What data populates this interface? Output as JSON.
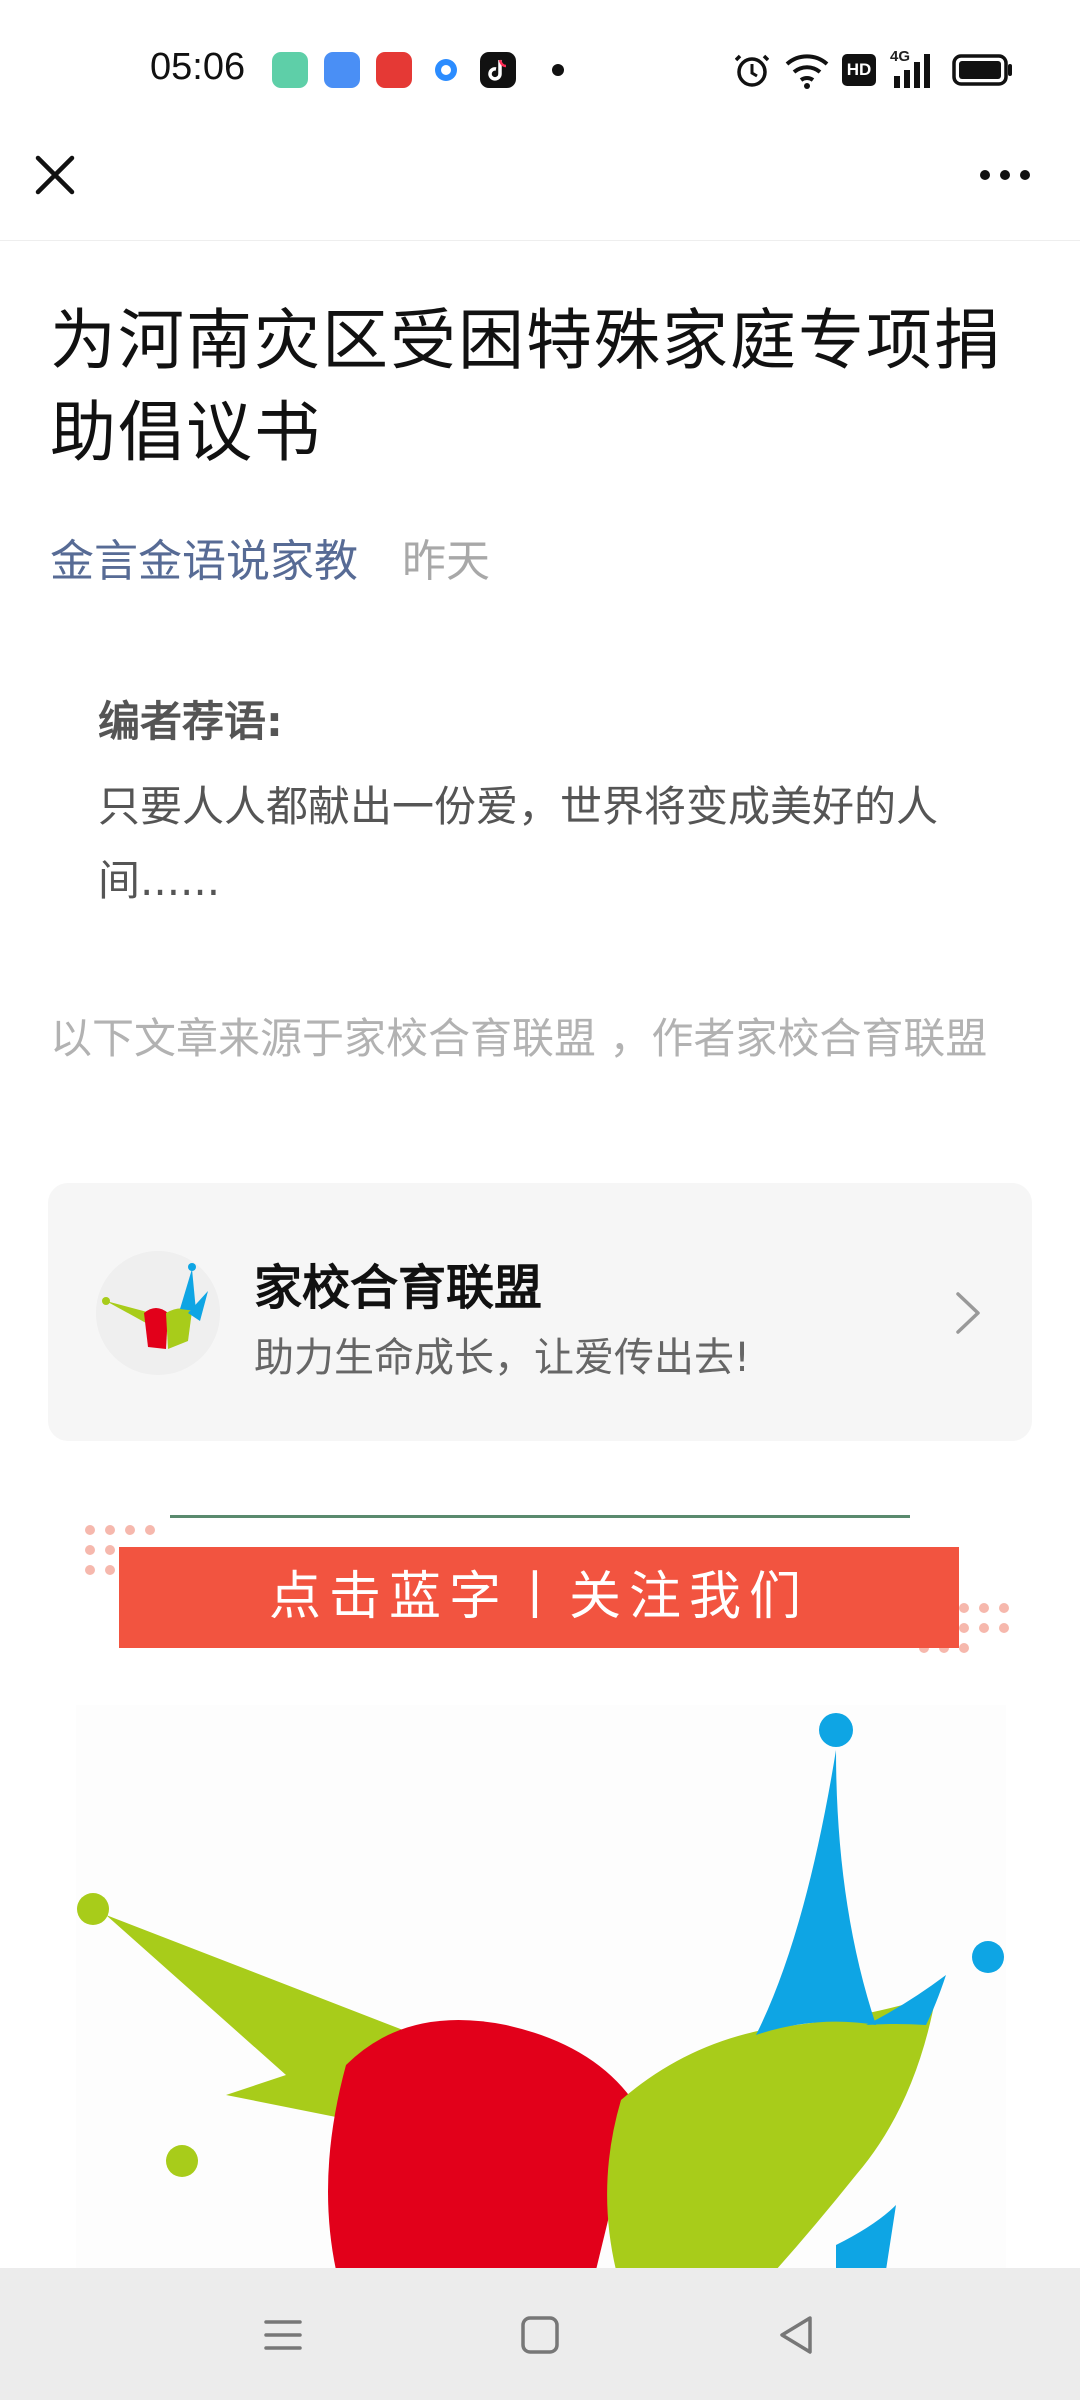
{
  "status_bar": {
    "time": "05:06",
    "icons": [
      "app-icon-teal",
      "app-icon-blue",
      "app-icon-red",
      "app-icon-blue-dot",
      "tiktok-icon",
      "alarm-icon",
      "wifi-icon",
      "hd-icon",
      "signal-4g-icon",
      "battery-icon"
    ],
    "hd_label": "HD",
    "network_label": "4G"
  },
  "nav": {
    "close_icon": "close-icon",
    "more_icon": "more-icon"
  },
  "article": {
    "title": "为河南灾区受困特殊家庭专项捐助倡议书",
    "account_name": "金言金语说家教",
    "date": "昨天",
    "editor_label": "编者荐语:",
    "editor_text": "只要人人都献出一份爱，世界将变成美好的人间......",
    "source_note": "以下文章来源于家校合育联盟 ，作者家校合育联盟"
  },
  "profile_card": {
    "name": "家校合育联盟",
    "description": "助力生命成长，让爱传出去!"
  },
  "banner": {
    "text": "点击蓝字丨关注我们",
    "color": "#f25440"
  },
  "colors": {
    "account_link": "#576b95",
    "logo_green": "#a8cc1a",
    "logo_red": "#e2001a",
    "logo_blue": "#0ea5e4"
  },
  "bottom_nav": {
    "icons": [
      "menu-icon",
      "home-square-icon",
      "back-triangle-icon"
    ]
  }
}
